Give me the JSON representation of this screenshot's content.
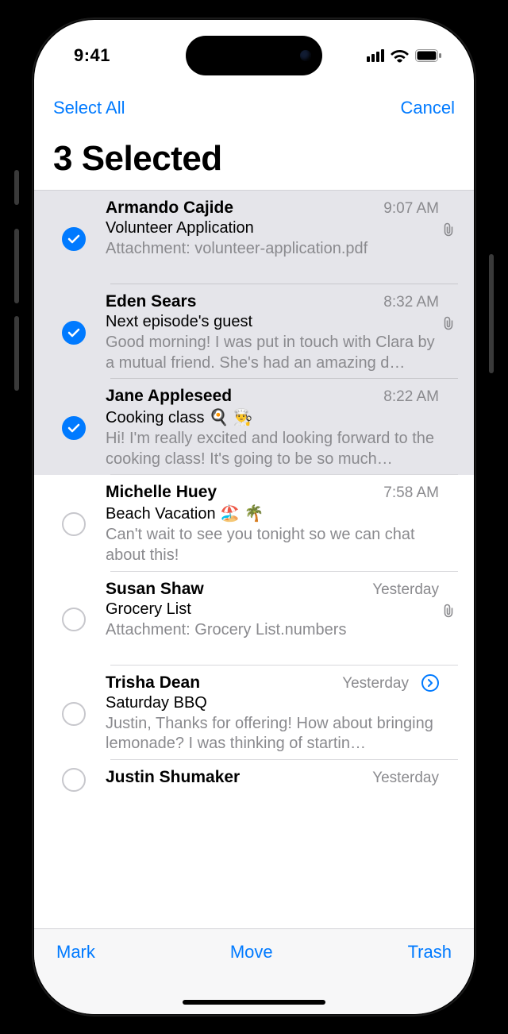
{
  "status": {
    "time": "9:41"
  },
  "nav": {
    "select_all": "Select All",
    "cancel": "Cancel"
  },
  "title": "3 Selected",
  "toolbar": {
    "mark": "Mark",
    "move": "Move",
    "trash": "Trash"
  },
  "messages": [
    {
      "sender": "Armando Cajide",
      "time": "9:07 AM",
      "subject": "Volunteer Application",
      "preview": "Attachment: volunteer-application.pdf",
      "has_attachment": true,
      "selected": true,
      "reply_indicator": false
    },
    {
      "sender": "Eden Sears",
      "time": "8:32 AM",
      "subject": "Next episode's guest",
      "preview": "Good morning! I was put in touch with Clara by a mutual friend. She's had an amazing d…",
      "has_attachment": true,
      "selected": true,
      "reply_indicator": false
    },
    {
      "sender": "Jane Appleseed",
      "time": "8:22 AM",
      "subject": "Cooking class 🍳 👨‍🍳",
      "preview": "Hi! I'm really excited and looking forward to the cooking class! It's going to be so much…",
      "has_attachment": false,
      "selected": true,
      "reply_indicator": false
    },
    {
      "sender": "Michelle Huey",
      "time": "7:58 AM",
      "subject": "Beach Vacation 🏖️ 🌴",
      "preview": "Can't wait to see you tonight so we can chat about this!",
      "has_attachment": false,
      "selected": false,
      "reply_indicator": false
    },
    {
      "sender": "Susan Shaw",
      "time": "Yesterday",
      "subject": "Grocery List",
      "preview": "Attachment: Grocery List.numbers",
      "has_attachment": true,
      "selected": false,
      "reply_indicator": false
    },
    {
      "sender": "Trisha Dean",
      "time": "Yesterday",
      "subject": "Saturday BBQ",
      "preview": "Justin, Thanks for offering! How about bringing lemonade? I was thinking of startin…",
      "has_attachment": false,
      "selected": false,
      "reply_indicator": true
    },
    {
      "sender": "Justin Shumaker",
      "time": "Yesterday",
      "subject": "",
      "preview": "",
      "has_attachment": false,
      "selected": false,
      "reply_indicator": false
    }
  ]
}
